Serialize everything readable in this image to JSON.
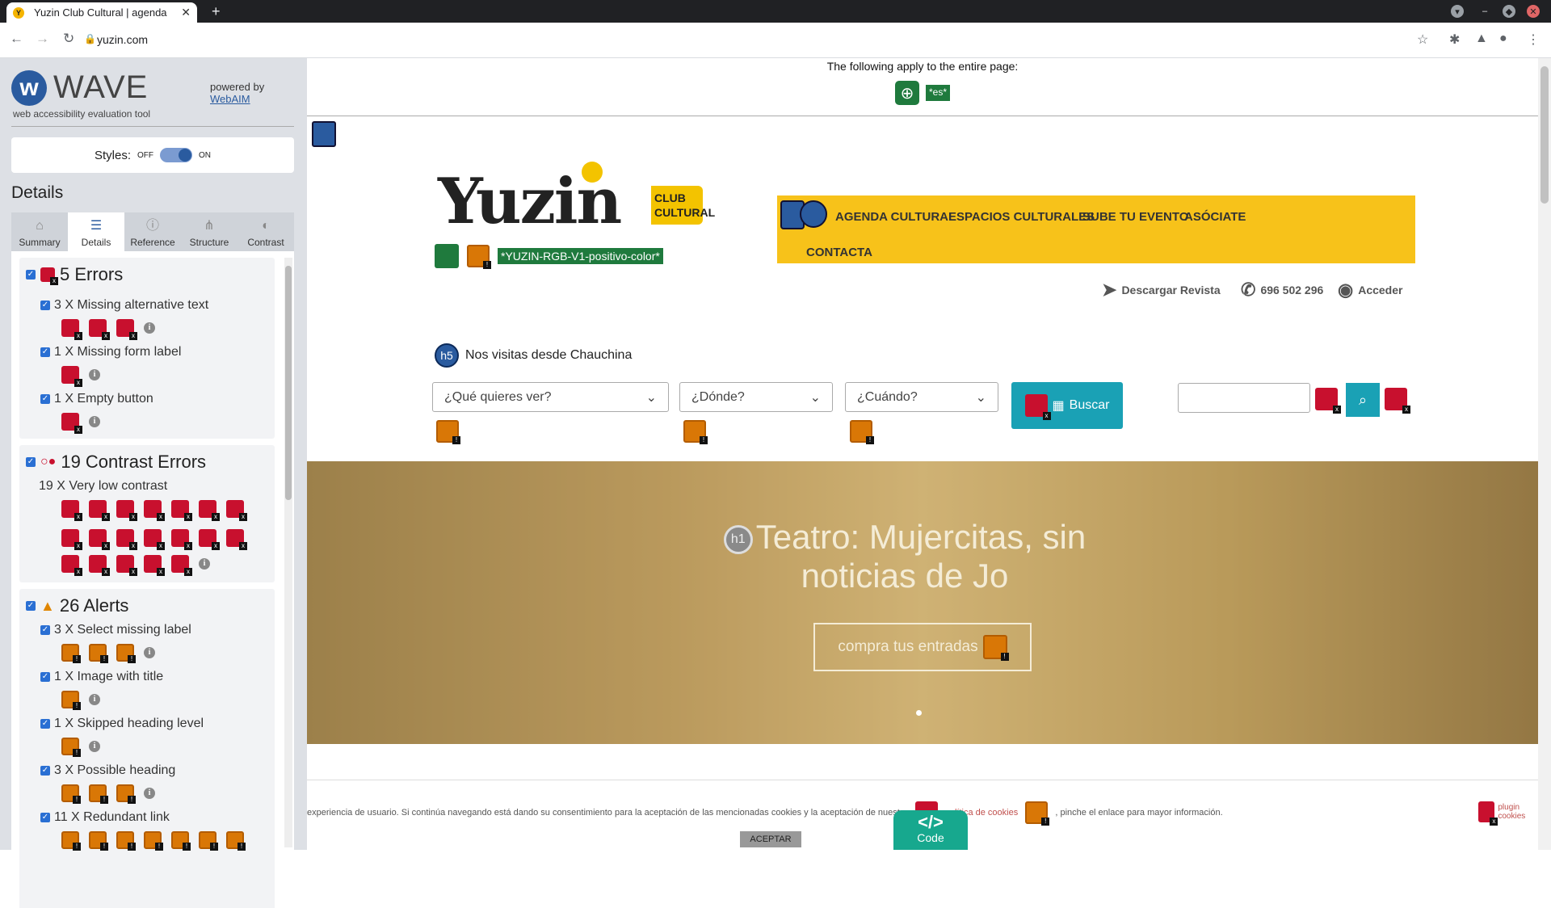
{
  "browser": {
    "tab_title": "Yuzin Club Cultural | agenda",
    "url": "yuzin.com"
  },
  "wave": {
    "logo": "WAVE",
    "subtitle": "web accessibility evaluation tool",
    "powered_by": "powered by",
    "webaim": "WebAIM",
    "styles_label": "Styles:",
    "off": "OFF",
    "on": "ON",
    "details_heading": "Details",
    "tabs": [
      {
        "label": "Summary",
        "icon": "home-icon"
      },
      {
        "label": "Details",
        "icon": "list-icon"
      },
      {
        "label": "Reference",
        "icon": "info-icon"
      },
      {
        "label": "Structure",
        "icon": "structure-icon"
      },
      {
        "label": "Contrast",
        "icon": "contrast-icon"
      }
    ],
    "errors": {
      "title": "5 Errors",
      "items": [
        {
          "label": "3 X Missing alternative text"
        },
        {
          "label": "1 X Missing form label"
        },
        {
          "label": "1 X Empty button"
        }
      ]
    },
    "contrast": {
      "title": "19 Contrast Errors",
      "item": "19 X Very low contrast"
    },
    "alerts": {
      "title": "26 Alerts",
      "items": [
        {
          "label": "3 X Select missing label"
        },
        {
          "label": "1 X Image with title"
        },
        {
          "label": "1 X Skipped heading level"
        },
        {
          "label": "3 X Possible heading"
        },
        {
          "label": "11 X Redundant link"
        }
      ]
    },
    "info_icon": "i"
  },
  "site": {
    "applies": "The following apply to the entire page:",
    "lang_tag": "*es*",
    "logo_text": "Yuzin",
    "club_text": "CLUB CULTURAL",
    "alt_tag": "*YUZIN-RGB-V1-positivo-color*",
    "nav": [
      "AGENDA CULTURAL",
      "ESPACIOS CULTURALES",
      "SUBE TU EVENTO",
      "ASÓCIATE",
      "CONTACTA"
    ],
    "util": [
      "Descargar Revista",
      "696 502 296",
      "Acceder"
    ],
    "h5_badge": "h5",
    "h5_text": "Nos visitas desde Chauchina",
    "selects": [
      "¿Qué quieres ver?",
      "¿Dónde?",
      "¿Cuándo?"
    ],
    "buscar": "Buscar",
    "hero_title": "Teatro: Mujercitas, sin noticias de Jo",
    "h1_badge": "h1",
    "hero_button": "compra tus entradas",
    "cookie_text": "experiencia de usuario. Si continúa navegando está dando su consentimiento para la aceptación de las mencionadas cookies y la aceptación de nuestra",
    "cookie_link": "política de cookies",
    "cookie_text2": ", pinche el enlace para mayor información.",
    "accept": "ACEPTAR",
    "plugin_cookies": "plugin cookies",
    "code_label": "Code",
    "code_glyph": "</>"
  }
}
